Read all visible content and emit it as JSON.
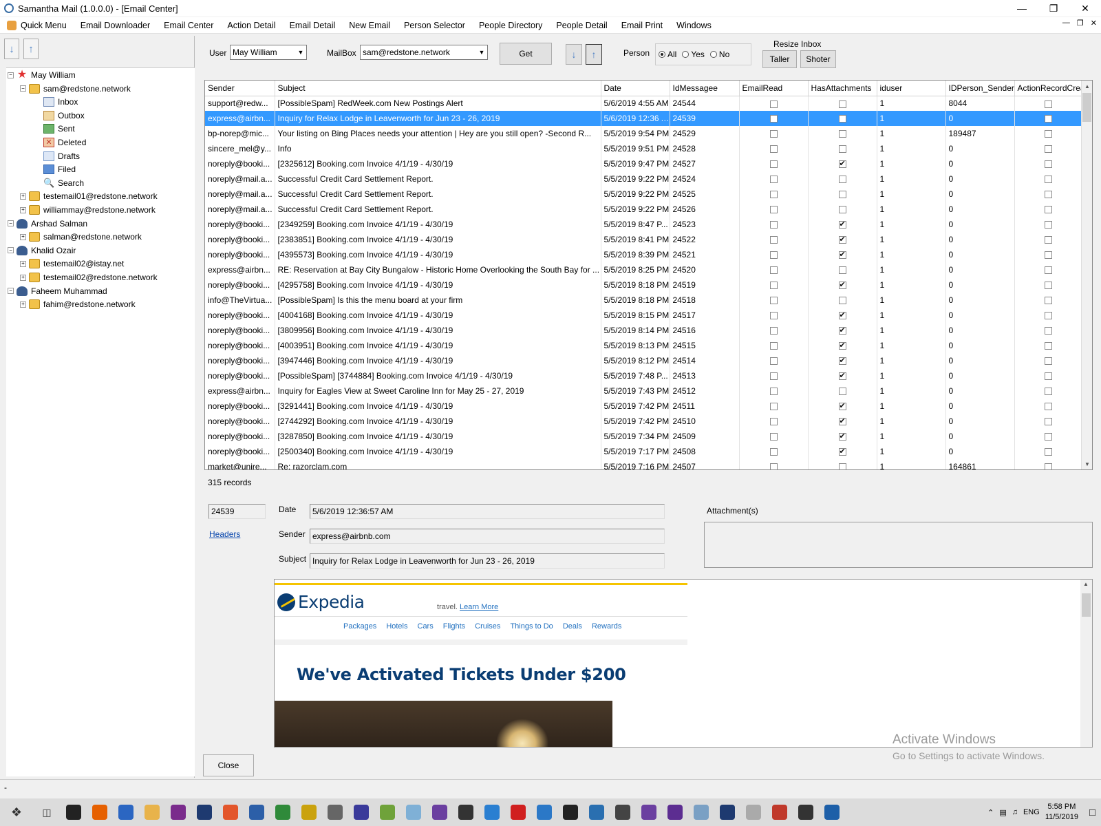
{
  "window": {
    "title": "Samantha Mail (1.0.0.0) - [Email Center]"
  },
  "menu": [
    "Quick Menu",
    "Email Downloader",
    "Email Center",
    "Action Detail",
    "Email Detail",
    "New Email",
    "Person Selector",
    "People Directory",
    "People Detail",
    "Email Print",
    "Windows"
  ],
  "tree": [
    {
      "label": "May William",
      "icon": "star-icon",
      "indent": 0,
      "exp": "−"
    },
    {
      "label": "sam@redstone.network",
      "icon": "folder-icon",
      "indent": 1,
      "exp": "−"
    },
    {
      "label": "Inbox",
      "icon": "inbox-icon",
      "indent": 2,
      "exp": ""
    },
    {
      "label": "Outbox",
      "icon": "outbox-icon",
      "indent": 2,
      "exp": ""
    },
    {
      "label": "Sent",
      "icon": "sent-icon",
      "indent": 2,
      "exp": ""
    },
    {
      "label": "Deleted",
      "icon": "deleted-icon",
      "indent": 2,
      "exp": ""
    },
    {
      "label": "Drafts",
      "icon": "drafts-icon",
      "indent": 2,
      "exp": ""
    },
    {
      "label": "Filed",
      "icon": "filed-icon",
      "indent": 2,
      "exp": ""
    },
    {
      "label": "Search",
      "icon": "search-icon",
      "indent": 2,
      "exp": ""
    },
    {
      "label": "testemail01@redstone.network",
      "icon": "folder-icon",
      "indent": 1,
      "exp": "+"
    },
    {
      "label": "williammay@redstone.network",
      "icon": "folder-icon",
      "indent": 1,
      "exp": "+"
    },
    {
      "label": "Arshad Salman",
      "icon": "user-icon",
      "indent": 0,
      "exp": "−"
    },
    {
      "label": "salman@redstone.network",
      "icon": "folder-icon",
      "indent": 1,
      "exp": "+"
    },
    {
      "label": "Khalid Ozair",
      "icon": "user-icon",
      "indent": 0,
      "exp": "−"
    },
    {
      "label": "testemail02@istay.net",
      "icon": "folder-icon",
      "indent": 1,
      "exp": "+"
    },
    {
      "label": "testemail02@redstone.network",
      "icon": "folder-icon",
      "indent": 1,
      "exp": "+"
    },
    {
      "label": "Faheem Muhammad",
      "icon": "user-icon",
      "indent": 0,
      "exp": "−"
    },
    {
      "label": "fahim@redstone.network",
      "icon": "folder-icon",
      "indent": 1,
      "exp": "+"
    }
  ],
  "toolbar": {
    "user_label": "User",
    "user_value": "May William",
    "mailbox_label": "MailBox",
    "mailbox_value": "sam@redstone.network",
    "get_label": "Get",
    "person_label": "Person",
    "radio_all": "All",
    "radio_yes": "Yes",
    "radio_no": "No",
    "resize_label": "Resize Inbox",
    "taller_label": "Taller",
    "shoter_label": "Shoter"
  },
  "grid": {
    "columns": [
      "Sender",
      "Subject",
      "Date",
      "IdMessagee",
      "EmailRead",
      "HasAttachments",
      "iduser",
      "IDPerson_Sender",
      "ActionRecordCrea"
    ],
    "rows": [
      [
        "support@redw...",
        "[PossibleSpam] RedWeek.com New Postings Alert",
        "5/6/2019 4:55 AM",
        "24544",
        false,
        false,
        "1",
        "8044",
        false
      ],
      [
        "express@airbn...",
        "Inquiry for Relax Lodge in Leavenworth for Jun 23 - 26, 2019",
        "5/6/2019 12:36 A...",
        "24539",
        false,
        false,
        "1",
        "0",
        false
      ],
      [
        "bp-norep@mic...",
        "Your listing on Bing Places needs your attention | Hey are you still open? -Second R...",
        "5/5/2019 9:54 PM",
        "24529",
        false,
        false,
        "1",
        "189487",
        false
      ],
      [
        "sincere_mel@y...",
        "Info",
        "5/5/2019 9:51 PM",
        "24528",
        false,
        false,
        "1",
        "0",
        false
      ],
      [
        "noreply@booki...",
        "[2325612] Booking.com Invoice 4/1/19 - 4/30/19",
        "5/5/2019 9:47 PM",
        "24527",
        false,
        true,
        "1",
        "0",
        false
      ],
      [
        "noreply@mail.a...",
        "Successful Credit Card Settlement Report.",
        "5/5/2019 9:22 PM",
        "24524",
        false,
        false,
        "1",
        "0",
        false
      ],
      [
        "noreply@mail.a...",
        "Successful Credit Card Settlement Report.",
        "5/5/2019 9:22 PM",
        "24525",
        false,
        false,
        "1",
        "0",
        false
      ],
      [
        "noreply@mail.a...",
        "Successful Credit Card Settlement Report.",
        "5/5/2019 9:22 PM",
        "24526",
        false,
        false,
        "1",
        "0",
        false
      ],
      [
        "noreply@booki...",
        "[2349259] Booking.com Invoice 4/1/19 - 4/30/19",
        "5/5/2019 8:47 P...",
        "24523",
        false,
        true,
        "1",
        "0",
        false
      ],
      [
        "noreply@booki...",
        "[2383851] Booking.com Invoice 4/1/19 - 4/30/19",
        "5/5/2019 8:41 PM",
        "24522",
        false,
        true,
        "1",
        "0",
        false
      ],
      [
        "noreply@booki...",
        "[4395573] Booking.com Invoice 4/1/19 - 4/30/19",
        "5/5/2019 8:39 PM",
        "24521",
        false,
        true,
        "1",
        "0",
        false
      ],
      [
        "express@airbn...",
        "RE: Reservation at Bay City Bungalow - Historic Home Overlooking the South Bay for ...",
        "5/5/2019 8:25 PM",
        "24520",
        false,
        false,
        "1",
        "0",
        false
      ],
      [
        "noreply@booki...",
        "[4295758] Booking.com Invoice 4/1/19 - 4/30/19",
        "5/5/2019 8:18 PM",
        "24519",
        false,
        true,
        "1",
        "0",
        false
      ],
      [
        "info@TheVirtua...",
        "[PossibleSpam] Is this the menu board at your firm",
        "5/5/2019 8:18 PM",
        "24518",
        false,
        false,
        "1",
        "0",
        false
      ],
      [
        "noreply@booki...",
        "[4004168] Booking.com Invoice 4/1/19 - 4/30/19",
        "5/5/2019 8:15 PM",
        "24517",
        false,
        true,
        "1",
        "0",
        false
      ],
      [
        "noreply@booki...",
        "[3809956] Booking.com Invoice 4/1/19 - 4/30/19",
        "5/5/2019 8:14 PM",
        "24516",
        false,
        true,
        "1",
        "0",
        false
      ],
      [
        "noreply@booki...",
        "[4003951] Booking.com Invoice 4/1/19 - 4/30/19",
        "5/5/2019 8:13 PM",
        "24515",
        false,
        true,
        "1",
        "0",
        false
      ],
      [
        "noreply@booki...",
        "[3947446] Booking.com Invoice 4/1/19 - 4/30/19",
        "5/5/2019 8:12 PM",
        "24514",
        false,
        true,
        "1",
        "0",
        false
      ],
      [
        "noreply@booki...",
        "[PossibleSpam] [3744884] Booking.com Invoice 4/1/19 - 4/30/19",
        "5/5/2019 7:48 P...",
        "24513",
        false,
        true,
        "1",
        "0",
        false
      ],
      [
        "express@airbn...",
        "Inquiry for Eagles View at Sweet Caroline Inn for May 25 - 27, 2019",
        "5/5/2019 7:43 PM",
        "24512",
        false,
        false,
        "1",
        "0",
        false
      ],
      [
        "noreply@booki...",
        "[3291441] Booking.com Invoice 4/1/19 - 4/30/19",
        "5/5/2019 7:42 PM",
        "24511",
        false,
        true,
        "1",
        "0",
        false
      ],
      [
        "noreply@booki...",
        "[2744292] Booking.com Invoice 4/1/19 - 4/30/19",
        "5/5/2019 7:42 PM",
        "24510",
        false,
        true,
        "1",
        "0",
        false
      ],
      [
        "noreply@booki...",
        "[3287850] Booking.com Invoice 4/1/19 - 4/30/19",
        "5/5/2019 7:34 PM",
        "24509",
        false,
        true,
        "1",
        "0",
        false
      ],
      [
        "noreply@booki...",
        "[2500340] Booking.com Invoice 4/1/19 - 4/30/19",
        "5/5/2019 7:17 PM",
        "24508",
        false,
        true,
        "1",
        "0",
        false
      ],
      [
        "market@unire...",
        "Re: razorclam.com",
        "5/5/2019 7:16 PM",
        "24507",
        false,
        false,
        "1",
        "164861",
        false
      ]
    ],
    "selected_index": 1
  },
  "records": "315 records",
  "detail": {
    "id": "24539",
    "date_label": "Date",
    "date_value": "5/6/2019 12:36:57 AM",
    "headers_link": "Headers",
    "sender_label": "Sender",
    "sender_value": "express@airbnb.com",
    "subject_label": "Subject",
    "subject_value": "Inquiry for Relax Lodge in Leavenworth for Jun 23 - 26, 2019",
    "attachments_label": "Attachment(s)"
  },
  "email_body": {
    "brand": "Expedia",
    "travel_text": "travel.",
    "learn_more": "Learn More",
    "nav": [
      "Packages",
      "Hotels",
      "Cars",
      "Flights",
      "Cruises",
      "Things to Do",
      "Deals",
      "Rewards"
    ],
    "headline": "We've Activated Tickets Under $200"
  },
  "close_label": "Close",
  "watermark": {
    "line1": "Activate Windows",
    "line2": "Go to Settings to activate Windows."
  },
  "statusbar": "-",
  "tray": {
    "lang": "ENG",
    "time": "5:58 PM",
    "date": "11/5/2019"
  },
  "colors": {
    "selection": "#3399ff",
    "link": "#0645ad",
    "brand": "#0a3d73"
  }
}
